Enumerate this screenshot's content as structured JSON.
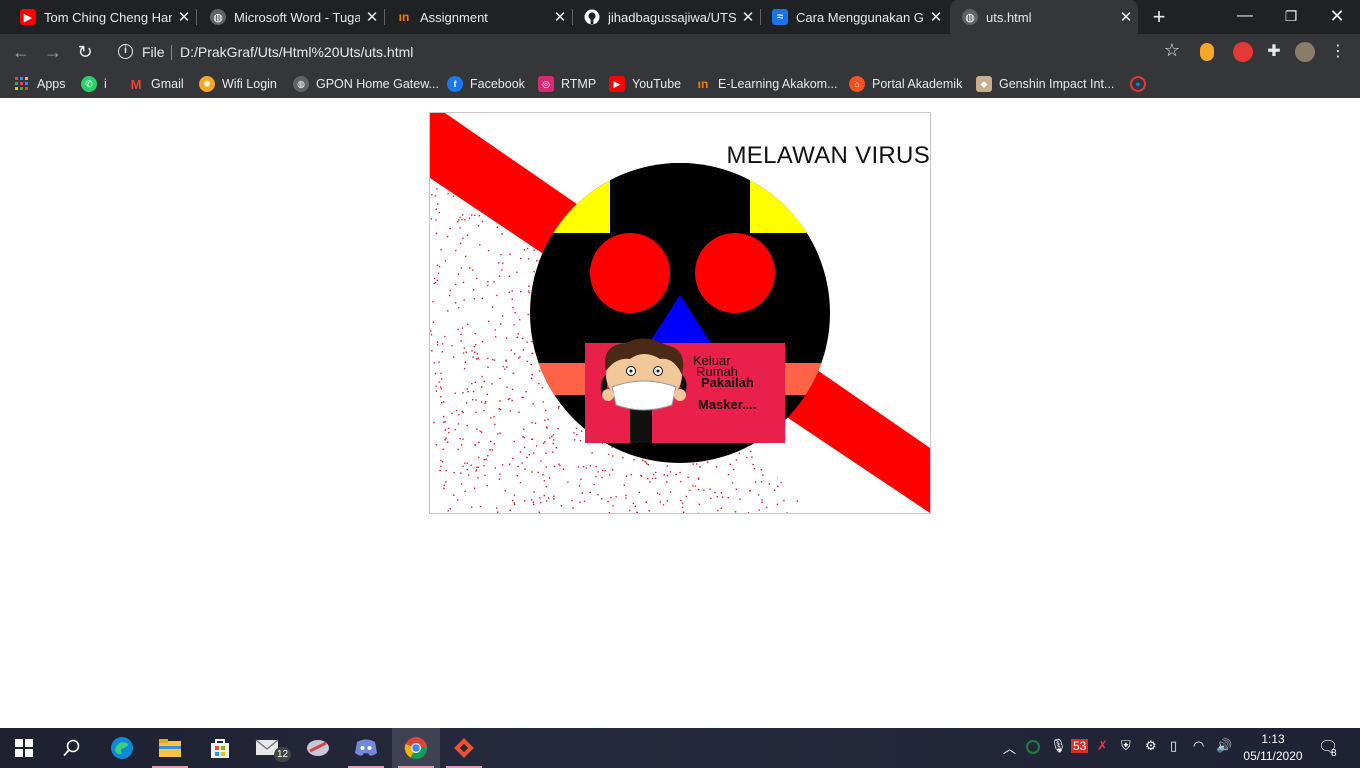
{
  "browser": {
    "tabs": [
      {
        "title": "Tom Ching Cheng Hanj",
        "icon": "youtube-icon",
        "color": "#ff0000",
        "active": false
      },
      {
        "title": "Microsoft Word - Tugas",
        "icon": "globe-icon",
        "color": "#9aa0a6",
        "active": false
      },
      {
        "title": "Assignment",
        "icon": "akakom-icon",
        "color": "#f57c00",
        "active": false
      },
      {
        "title": "jihadbagussajiwa/UTS-(",
        "icon": "github-icon",
        "color": "#ffffff",
        "active": false
      },
      {
        "title": "Cara Menggunakan Git",
        "icon": "codepolitan-icon",
        "color": "#1a73e8",
        "active": false
      },
      {
        "title": "uts.html",
        "icon": "globe-icon",
        "color": "#9aa0a6",
        "active": true
      }
    ],
    "new_tab": "+",
    "address": {
      "scheme": "File",
      "url": "D:/PrakGraf/Uts/Html%20Uts/uts.html"
    },
    "bookmarks": [
      {
        "label": "Apps",
        "icon": "apps-grid-icon"
      },
      {
        "label": "i",
        "icon": "whatsapp-icon"
      },
      {
        "label": "Gmail",
        "icon": "gmail-icon"
      },
      {
        "label": "Wifi Login",
        "icon": "wifi-login-icon"
      },
      {
        "label": "GPON Home Gatew...",
        "icon": "globe-icon"
      },
      {
        "label": "Facebook",
        "icon": "facebook-icon"
      },
      {
        "label": "RTMP",
        "icon": "instagram-icon"
      },
      {
        "label": "YouTube",
        "icon": "youtube-icon"
      },
      {
        "label": "E-Learning Akakom...",
        "icon": "akakom-icon"
      },
      {
        "label": "Portal Akademik",
        "icon": "portal-icon"
      },
      {
        "label": "Genshin Impact Int...",
        "icon": "genshin-icon"
      },
      {
        "label": "",
        "icon": "circle-logo-icon"
      }
    ]
  },
  "page": {
    "title_text": "MELAWAN VIRUS",
    "poster": {
      "line1": "Keluar",
      "line2": "Rumah",
      "line3": "Pakailah",
      "line4": "Masker...."
    },
    "colors": {
      "diagonal": "#ff0000",
      "face": "#000000",
      "ears": "#ffff00",
      "eyes": "#ff0000",
      "nose": "#0000ff",
      "band": "#ff6347",
      "poster_bg": "#e8204a",
      "dots": "#e02020"
    }
  },
  "taskbar": {
    "apps": [
      "start-icon",
      "search-icon",
      "edge-icon",
      "file-explorer-icon",
      "store-icon",
      "mail-icon",
      "snipping-icon",
      "discord-icon",
      "chrome-icon",
      "git-icon"
    ],
    "mail_badge": "12",
    "tray_badge": "53",
    "clock_time": "1:13",
    "clock_date": "05/11/2020",
    "notification_count": "8"
  }
}
